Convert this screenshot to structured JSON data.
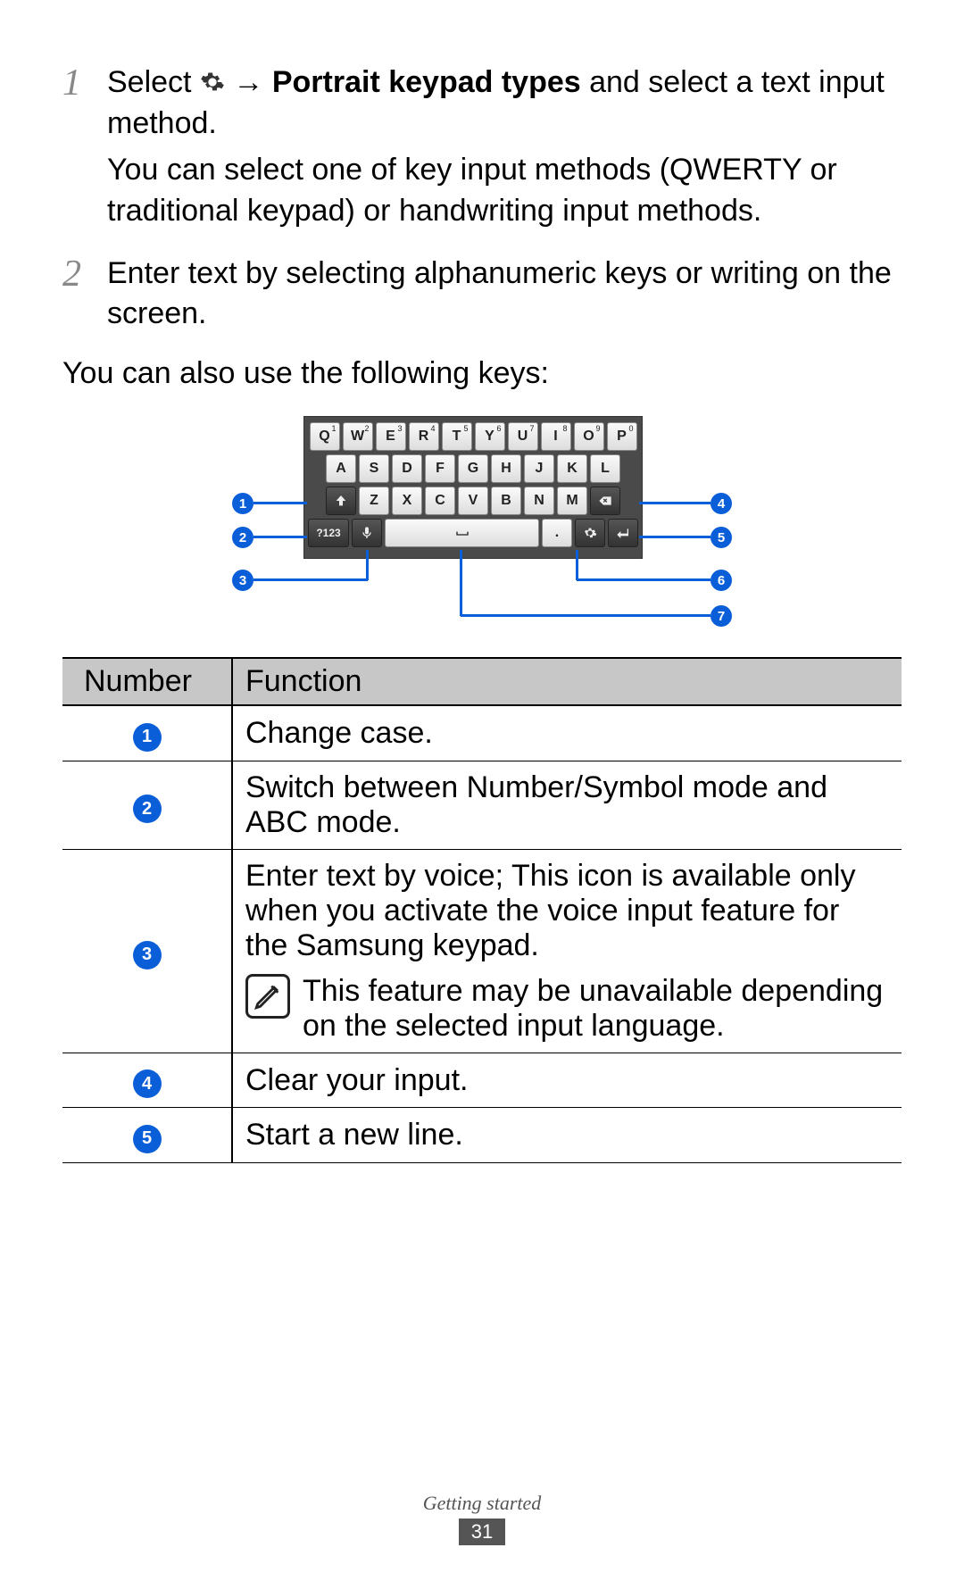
{
  "steps": [
    {
      "num": "1",
      "pre": "Select ",
      "bold": "Portrait keypad types",
      "post": " and select a text input method.",
      "extra": "You can select one of key input methods (QWERTY or traditional keypad) or handwriting input methods."
    },
    {
      "num": "2",
      "pre": "Enter text by selecting alphanumeric keys or writing on the screen.",
      "bold": "",
      "post": "",
      "extra": ""
    }
  ],
  "after_steps": "You can also use the following keys:",
  "arrow": " → ",
  "keyboard": {
    "row1": [
      {
        "l": "Q",
        "s": "1"
      },
      {
        "l": "W",
        "s": "2"
      },
      {
        "l": "E",
        "s": "3"
      },
      {
        "l": "R",
        "s": "4"
      },
      {
        "l": "T",
        "s": "5"
      },
      {
        "l": "Y",
        "s": "6"
      },
      {
        "l": "U",
        "s": "7"
      },
      {
        "l": "I",
        "s": "8"
      },
      {
        "l": "O",
        "s": "9"
      },
      {
        "l": "P",
        "s": "0"
      }
    ],
    "row2": [
      "A",
      "S",
      "D",
      "F",
      "G",
      "H",
      "J",
      "K",
      "L"
    ],
    "row3": [
      "Z",
      "X",
      "C",
      "V",
      "B",
      "N",
      "M"
    ],
    "mode_label": "?123",
    "period": "."
  },
  "callouts": [
    "1",
    "2",
    "3",
    "4",
    "5",
    "6",
    "7"
  ],
  "table": {
    "headers": [
      "Number",
      "Function"
    ],
    "rows": [
      {
        "n": "1",
        "f": "Change case."
      },
      {
        "n": "2",
        "f": "Switch between Number/Symbol mode and ABC mode."
      },
      {
        "n": "3",
        "f": "Enter text by voice; This icon is available only when you activate the voice input feature for the Samsung keypad.",
        "note": "This feature may be unavailable depending on the selected input language."
      },
      {
        "n": "4",
        "f": "Clear your input."
      },
      {
        "n": "5",
        "f": "Start a new line."
      }
    ]
  },
  "footer": {
    "section": "Getting started",
    "page": "31"
  }
}
